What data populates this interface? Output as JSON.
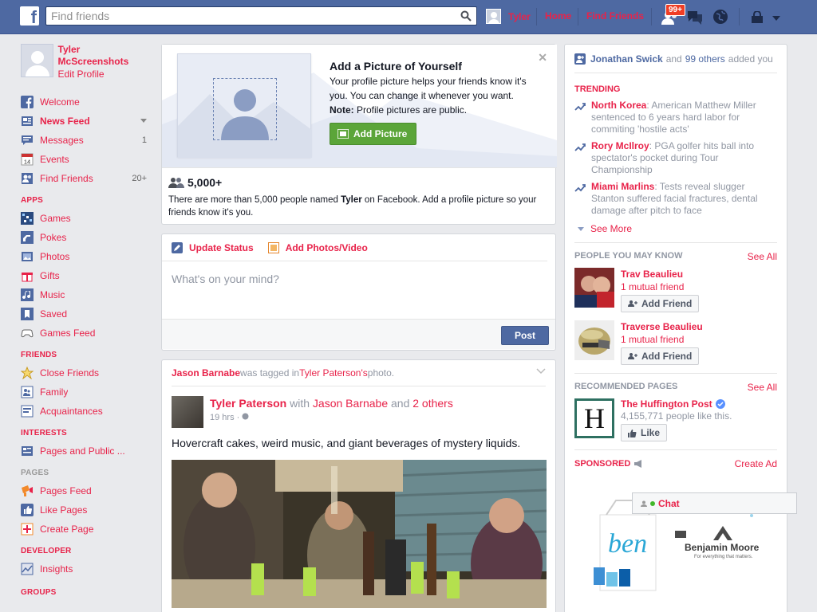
{
  "topbar": {
    "search_placeholder": "Find friends",
    "user_name": "Tyler",
    "home": "Home",
    "find_friends": "Find Friends",
    "friend_requests_badge": "99+"
  },
  "left": {
    "profile_name": "Tyler McScreenshots",
    "edit_profile": "Edit Profile",
    "main_items": [
      {
        "label": "Welcome",
        "icon": "facebook-icon",
        "count": ""
      },
      {
        "label": "News Feed",
        "icon": "news-feed-icon",
        "count": ""
      },
      {
        "label": "Messages",
        "icon": "messages-icon",
        "count": "1"
      },
      {
        "label": "Events",
        "icon": "events-calendar-icon",
        "count": ""
      },
      {
        "label": "Find Friends",
        "icon": "find-friends-icon",
        "count": "20+"
      }
    ],
    "apps_header": "APPS",
    "apps": [
      {
        "label": "Games",
        "icon": "games-icon"
      },
      {
        "label": "Pokes",
        "icon": "pokes-icon"
      },
      {
        "label": "Photos",
        "icon": "photos-icon"
      },
      {
        "label": "Gifts",
        "icon": "gifts-icon"
      },
      {
        "label": "Music",
        "icon": "music-icon"
      },
      {
        "label": "Saved",
        "icon": "saved-icon"
      },
      {
        "label": "Games Feed",
        "icon": "games-feed-icon"
      }
    ],
    "friends_header": "FRIENDS",
    "friends": [
      {
        "label": "Close Friends",
        "icon": "star-icon"
      },
      {
        "label": "Family",
        "icon": "family-icon"
      },
      {
        "label": "Acquaintances",
        "icon": "acquaintances-icon"
      }
    ],
    "interests_header": "INTERESTS",
    "interests": [
      {
        "label": "Pages and Public ...",
        "icon": "pages-public-icon"
      }
    ],
    "pages_header": "PAGES",
    "pages": [
      {
        "label": "Pages Feed",
        "icon": "pages-feed-icon"
      },
      {
        "label": "Like Pages",
        "icon": "like-pages-icon"
      },
      {
        "label": "Create Page",
        "icon": "create-page-icon"
      }
    ],
    "developer_header": "DEVELOPER",
    "developer": [
      {
        "label": "Insights",
        "icon": "insights-icon"
      }
    ],
    "groups_header": "GROUPS"
  },
  "picture_card": {
    "title": "Add a Picture of Yourself",
    "body": "Your profile picture helps your friends know it's you. You can change it whenever you want.",
    "note_label": "Note:",
    "note_text": " Profile pictures are public.",
    "button": "Add Picture",
    "count": "5,000+",
    "footer_pre": "There are more than 5,000 people named ",
    "footer_name": "Tyler",
    "footer_post": " on Facebook. Add a profile picture so your friends know it's you."
  },
  "composer": {
    "tab_status": "Update Status",
    "tab_photos": "Add Photos/Video",
    "placeholder": "What's on your mind?",
    "post_button": "Post"
  },
  "story": {
    "head_actor": "Jason Barnabe",
    "head_mid": " was tagged in ",
    "head_target": "Tyler Paterson's",
    "head_end": " photo.",
    "author": "Tyler Paterson",
    "with": " with ",
    "with_name": "Jason Barnabe",
    "and": " and ",
    "others": "2 others",
    "time": "19 hrs · ",
    "text": "Hovercraft cakes, weird music, and giant beverages of mystery liquids."
  },
  "right": {
    "added_name": "Jonathan Swick",
    "added_and": "and",
    "added_others": "99 others",
    "added_end": "added you",
    "trending_header": "TRENDING",
    "trending": [
      {
        "topic": "North Korea",
        "text": ": American Matthew Miller sentenced to 6 years hard labor for commiting 'hostile acts'"
      },
      {
        "topic": "Rory McIlroy",
        "text": ": PGA golfer hits ball into spectator's pocket during Tour Championship"
      },
      {
        "topic": "Miami Marlins",
        "text": ": Tests reveal slugger Stanton suffered facial fractures, dental damage after pitch to face"
      }
    ],
    "see_more": "See More",
    "pymk_header": "PEOPLE YOU MAY KNOW",
    "see_all": "See All",
    "people": [
      {
        "name": "Trav Beaulieu",
        "mutual": "1 mutual friend",
        "button": "Add Friend"
      },
      {
        "name": "Traverse Beaulieu",
        "mutual": "1 mutual friend",
        "button": "Add Friend"
      }
    ],
    "rec_header": "RECOMMENDED PAGES",
    "rec_see_all": "See All",
    "page_name": "The Huffington Post",
    "page_likes": "4,155,771 people like this.",
    "like_button": "Like",
    "huff_logo": "H",
    "sponsored_header": "SPONSORED",
    "create_ad": "Create Ad",
    "ad_brand": "Benjamin Moore",
    "ad_tagline": "For everything that matters.",
    "ad_script": "ben"
  },
  "chat": {
    "label": "Chat"
  },
  "colors": {
    "topbar": "#4e69a2",
    "accent": "#e8234a",
    "green": "#5ba539"
  }
}
